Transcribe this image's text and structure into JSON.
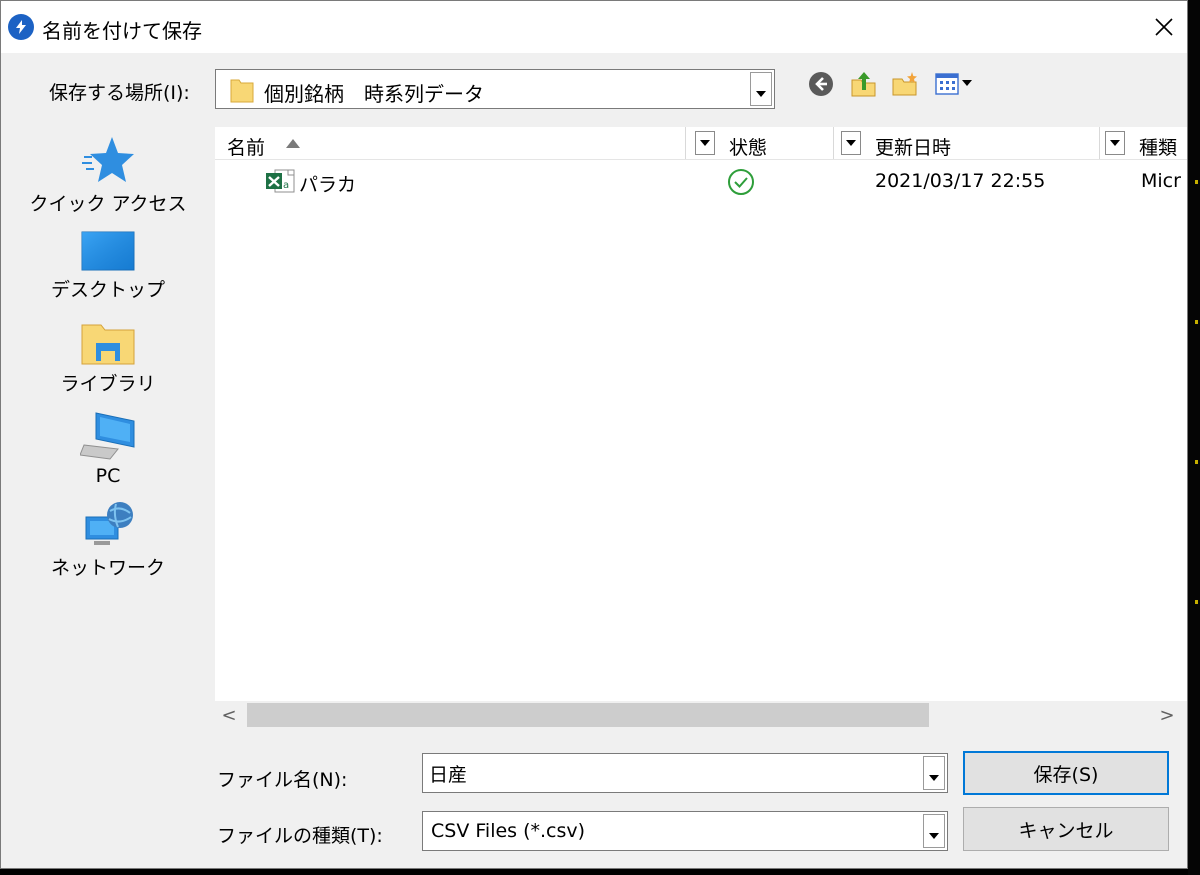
{
  "window": {
    "title": "名前を付けて保存",
    "close_glyph": "✕"
  },
  "location": {
    "label": "保存する場所(I):",
    "current_folder": "個別銘柄　時系列データ"
  },
  "toolbar": {
    "icons": [
      "back-icon",
      "up-folder-icon",
      "new-folder-icon",
      "view-menu-icon"
    ]
  },
  "places": [
    {
      "label": "クイック アクセス",
      "icon": "star-icon"
    },
    {
      "label": "デスクトップ",
      "icon": "desktop-icon"
    },
    {
      "label": "ライブラリ",
      "icon": "library-icon"
    },
    {
      "label": "PC",
      "icon": "computer-icon"
    },
    {
      "label": "ネットワーク",
      "icon": "network-icon"
    }
  ],
  "filelist": {
    "columns": [
      {
        "label": "名前",
        "sorted": "ascending"
      },
      {
        "label": "状態"
      },
      {
        "label": "更新日時"
      },
      {
        "label": "種類"
      }
    ],
    "files": [
      {
        "name": "パラカ",
        "status": "synced",
        "modified": "2021/03/17 22:55",
        "type": "Micr"
      }
    ],
    "scroll": {
      "left_glyph": "<",
      "right_glyph": ">"
    }
  },
  "form": {
    "filename_label": "ファイル名(N):",
    "filename_value": "日産",
    "filetype_label": "ファイルの種類(T):",
    "filetype_value": "CSV Files (*.csv)"
  },
  "buttons": {
    "save": "保存(S)",
    "cancel": "キャンセル"
  },
  "colors": {
    "accent": "#0078d7",
    "folder": "#f8d775",
    "excel": "#1e7145",
    "status_ok": "#2e9e3a",
    "app_icon": "#1c62c4"
  }
}
